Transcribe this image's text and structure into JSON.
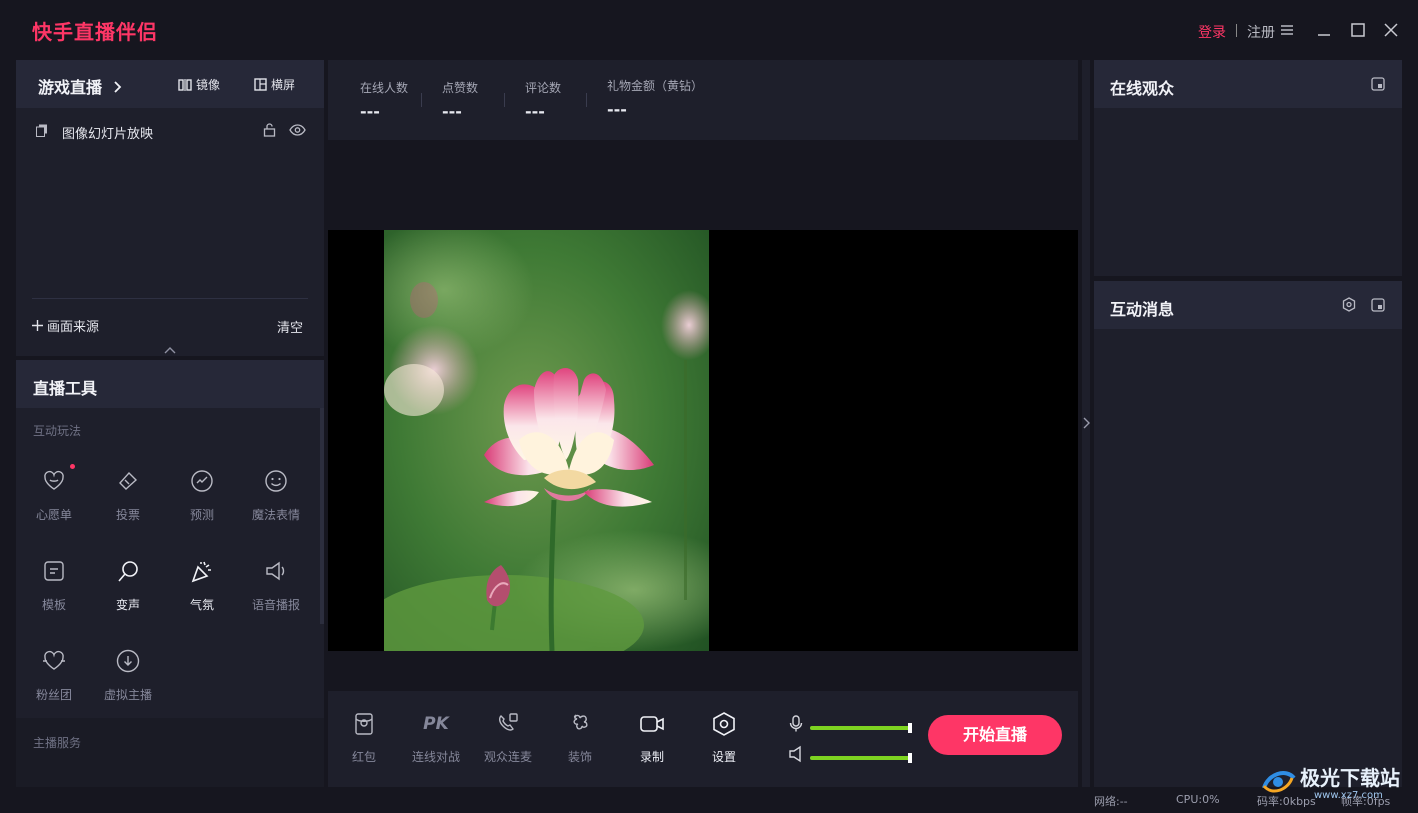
{
  "app": {
    "title": "快手直播伴侣",
    "login": "登录",
    "register": "注册"
  },
  "scene_panel": {
    "title": "游戏直播",
    "mirror_label": "镜像",
    "landscape_label": "横屏",
    "sources": [
      {
        "name": "图像幻灯片放映"
      }
    ],
    "add_source_label": "画面来源",
    "clear_label": "清空"
  },
  "tools_panel": {
    "title": "直播工具",
    "section_interactive": "互动玩法",
    "section_host_service": "主播服务",
    "items": [
      {
        "label": "心愿单",
        "icon": "wishlist-heart-icon",
        "badge": true
      },
      {
        "label": "投票",
        "icon": "vote-icon"
      },
      {
        "label": "预测",
        "icon": "predict-icon"
      },
      {
        "label": "魔法表情",
        "icon": "smiley-icon"
      },
      {
        "label": "模板",
        "icon": "template-icon"
      },
      {
        "label": "变声",
        "icon": "voice-change-icon"
      },
      {
        "label": "气氛",
        "icon": "party-popper-icon"
      },
      {
        "label": "语音播报",
        "icon": "speaker-icon"
      },
      {
        "label": "粉丝团",
        "icon": "fan-club-heart-icon"
      },
      {
        "label": "虚拟主播",
        "icon": "download-circle-icon"
      }
    ]
  },
  "stats": [
    {
      "label": "在线人数",
      "value": "---"
    },
    {
      "label": "点赞数",
      "value": "---"
    },
    {
      "label": "评论数",
      "value": "---"
    },
    {
      "label": "礼物金额（黄钻）",
      "value": "---"
    }
  ],
  "bottom_toolbar": {
    "items": [
      {
        "label": "红包",
        "icon": "red-packet-icon"
      },
      {
        "label": "连线对战",
        "icon": "pk-icon"
      },
      {
        "label": "观众连麦",
        "icon": "phone-link-icon"
      },
      {
        "label": "装饰",
        "icon": "decoration-icon"
      },
      {
        "label": "录制",
        "icon": "record-camera-icon"
      },
      {
        "label": "设置",
        "icon": "settings-hex-icon"
      }
    ],
    "mic_level": 1.0,
    "speaker_level": 1.0,
    "start_button": "开始直播"
  },
  "right_panel": {
    "online_audience_title": "在线观众",
    "interaction_messages_title": "互动消息"
  },
  "status_bar": {
    "network": "网络:--",
    "cpu": "CPU:0%",
    "bitrate": "码率:0kbps",
    "framerate": "帧率:0fps"
  },
  "watermark": {
    "text": "极光下载站",
    "url": "www.xz7.com"
  },
  "colors": {
    "accent": "#fe3666",
    "level_green": "#7ed321",
    "panel_bg": "#1e1f2b",
    "panel_head": "#262838"
  }
}
